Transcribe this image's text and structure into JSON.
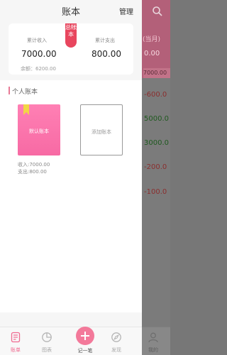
{
  "drawer": {
    "title": "账本",
    "manage_label": "管理"
  },
  "summary": {
    "income_label": "累计收入",
    "income_value": "7000.00",
    "expense_label": "累计支出",
    "expense_value": "800.00",
    "balance_text": "余额：6200.00",
    "ribbon_text": "总帐本"
  },
  "section": {
    "title": "个人账本"
  },
  "books": [
    {
      "name": "默认账本",
      "income_text": "收入:7000.00",
      "expense_text": "支出:800.00"
    }
  ],
  "add_book_label": "添加账本",
  "background": {
    "header_text": "(当月)",
    "header_value": "0.00",
    "row_bar_text": "7000.00",
    "amounts": [
      {
        "text": "-600.0",
        "color": "#8b2e2e"
      },
      {
        "text": "5000.0",
        "color": "#1f5a1f"
      },
      {
        "text": "3000.0",
        "color": "#1f5a1f"
      },
      {
        "text": "-200.0",
        "color": "#8b2e2e"
      },
      {
        "text": "-100.0",
        "color": "#8b2e2e"
      }
    ]
  },
  "nav": {
    "items": [
      {
        "label": "账单",
        "icon": "bill-icon",
        "active": true
      },
      {
        "label": "图表",
        "icon": "pie-chart-icon",
        "active": false
      },
      {
        "label": "记一笔",
        "icon": "add-icon",
        "active": false
      },
      {
        "label": "发现",
        "icon": "compass-icon",
        "active": false
      },
      {
        "label": "我的",
        "icon": "user-icon",
        "active": false
      }
    ]
  },
  "colors": {
    "accent": "#f06a90",
    "ribbon": "#e8465e",
    "book_cover": "#f76aa4",
    "bookmark": "#f2d645"
  }
}
